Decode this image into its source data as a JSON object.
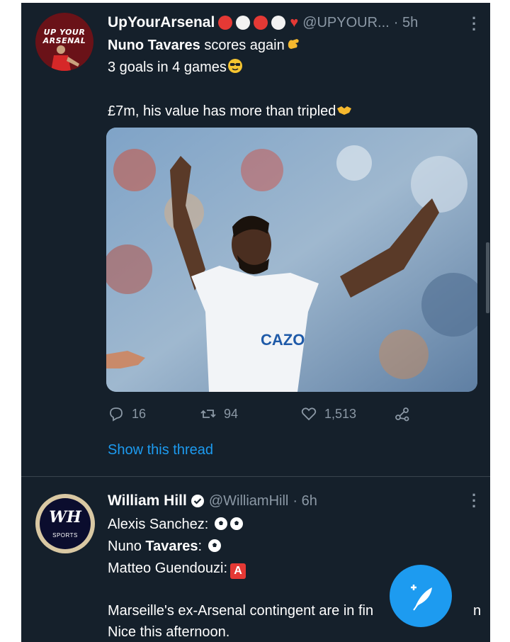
{
  "tweets": [
    {
      "avatar_text": "UP YOUR ARSENAL",
      "name": "UpYourArsenal",
      "handle": "@UPYOUR...",
      "time": "· 5h",
      "lines": {
        "l1_bold": "Nuno Tavares",
        "l1_rest": " scores again",
        "l2": "3 goals in 4 games",
        "l3": "£7m, his value has more than tripled"
      },
      "media_icon": "player-celebrating-photo",
      "media_caption": "CAZO",
      "stats": {
        "replies": "16",
        "retweets": "94",
        "likes": "1,513"
      },
      "show_thread": "Show this thread"
    },
    {
      "avatar_text": "WH",
      "avatar_sub": "SPORTS",
      "name": "William Hill",
      "handle": "@WilliamHill",
      "time": "· 6h",
      "lines": {
        "l1": "Alexis Sanchez:",
        "l2_bold": "Tavares",
        "l2_pre": "Nuno ",
        "l2_post": ":",
        "l3": "Matteo Guendouzi:",
        "l3_badge": "A",
        "l4": "Marseille's ex-Arsenal contingent are in fin",
        "l4_tail": "n",
        "l5": "Nice this afternoon."
      }
    }
  ],
  "colors": {
    "background": "#15202b",
    "accent": "#1d9bf0",
    "muted": "#8b98a5"
  }
}
